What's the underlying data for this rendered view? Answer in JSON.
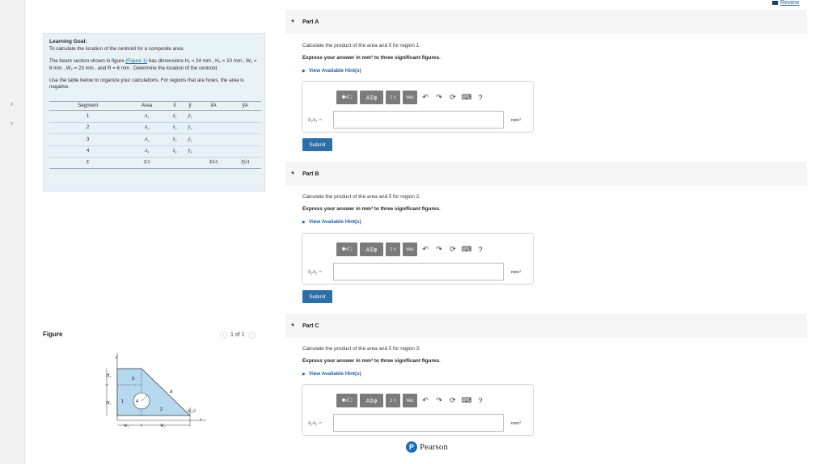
{
  "review": {
    "label": "Review"
  },
  "goal": {
    "title": "Learning Goal:",
    "line1": "To calculate the location of the centroid for a composite area.",
    "desc_pre": "The beam section shown in figure ",
    "fig_link": "(Figure 1)",
    "desc_dims": " has dimensions H₁ = 24 mm , H₂ = 10 mm , W₁ = 8 mm , W₂ = 23 mm , and R = 6 mm . Determine the location of the centroid.",
    "table_intro": "Use the table below to organize your calculations. For regions that are holes, the area is negative."
  },
  "table": {
    "headers": [
      "Segment",
      "Area",
      "x̃",
      "ỹ",
      "x̃A",
      "ỹA"
    ],
    "rows": [
      [
        "1",
        "A₁",
        "x̃₁",
        "ỹ₁"
      ],
      [
        "2",
        "A₂",
        "x̃₂",
        "ỹ₂"
      ],
      [
        "3",
        "A₃",
        "x̃₃",
        "ỹ₃"
      ],
      [
        "4",
        "A₄",
        "x̃₄",
        "ỹ₄"
      ]
    ],
    "sum_row": [
      "Σ",
      "ΣA",
      "",
      "",
      "Σx̃A",
      "ΣỹA"
    ]
  },
  "figure": {
    "label": "Figure",
    "pager": "1 of 1",
    "labels": {
      "h2": "H₂",
      "h1": "H₁",
      "w1": "W₁",
      "w2": "W₂",
      "r": "R",
      "h1_half": "H₁/2",
      "y": "y",
      "x": "x",
      "r1": "1",
      "r2": "2",
      "r3": "3",
      "r4": "4"
    }
  },
  "parts": [
    {
      "title": "Part A",
      "question": "Calculate the product of the area and x̃ for region 1.",
      "express": "Express your answer in mm³ to three significant figures.",
      "hint": "View Available Hint(s)",
      "answer_label": "x̃₁A₁ =",
      "unit": "mm³",
      "submit": "Submit"
    },
    {
      "title": "Part B",
      "question": "Calculate the product of the area and x̃ for region 2.",
      "express": "Express your answer in mm³ to three significant figures.",
      "hint": "View Available Hint(s)",
      "answer_label": "x̃₂A₂ =",
      "unit": "mm³",
      "submit": "Submit"
    },
    {
      "title": "Part C",
      "question": "Calculate the product of the area and x̃ for region 3.",
      "express": "Express your answer in mm³ to three significant figures.",
      "hint": "View Available Hint(s)",
      "answer_label": "x̃₃A₃ =",
      "unit": "mm³"
    }
  ],
  "toolbar": {
    "templates": "■√□",
    "greek": "AΣφ",
    "arrows": "↧↥",
    "vec": "vec",
    "undo": "↶",
    "redo": "↷",
    "reset": "⟳",
    "keyboard": "⌨",
    "help": "?"
  },
  "footer": {
    "brand": "Pearson",
    "logo_letter": "P"
  }
}
